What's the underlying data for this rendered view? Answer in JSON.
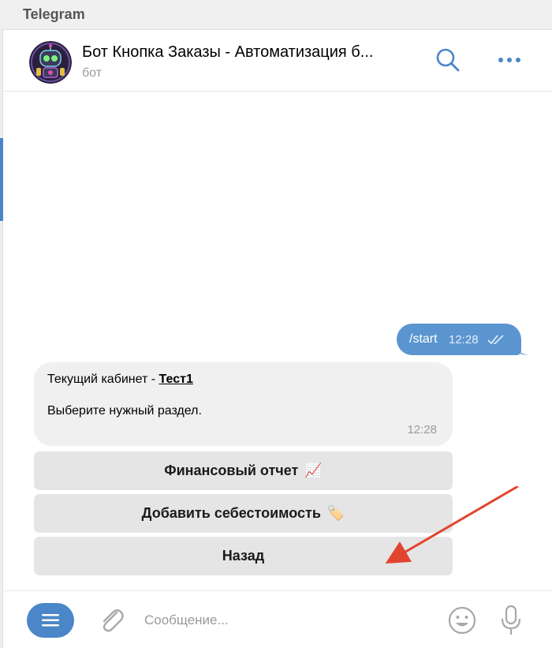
{
  "app": {
    "title": "Telegram"
  },
  "chat": {
    "title": "Бот Кнопка Заказы - Автоматизация б...",
    "subtitle": "бот",
    "avatar_icon": "robot-avatar-icon"
  },
  "messages": {
    "outgoing": {
      "text": "/start",
      "time": "12:28",
      "status_icon": "double-check-icon"
    },
    "incoming": {
      "line1_prefix": "Текущий кабинет - ",
      "cabinet": "Тест1",
      "line2": "Выберите нужный раздел.",
      "time": "12:28"
    }
  },
  "keyboard": {
    "buttons": [
      {
        "label": "Финансовый отчет",
        "emoji": "📈"
      },
      {
        "label": "Добавить себестоимость",
        "emoji": "🏷️"
      },
      {
        "label": "Назад",
        "emoji": ""
      }
    ]
  },
  "input": {
    "placeholder": "Сообщение..."
  },
  "colors": {
    "accent": "#4a86c8",
    "outgoing_bubble": "#5b95cf",
    "incoming_bubble": "#f0f0f0",
    "keyboard_button": "#e5e5e5",
    "annotation_arrow": "#e2452f"
  }
}
